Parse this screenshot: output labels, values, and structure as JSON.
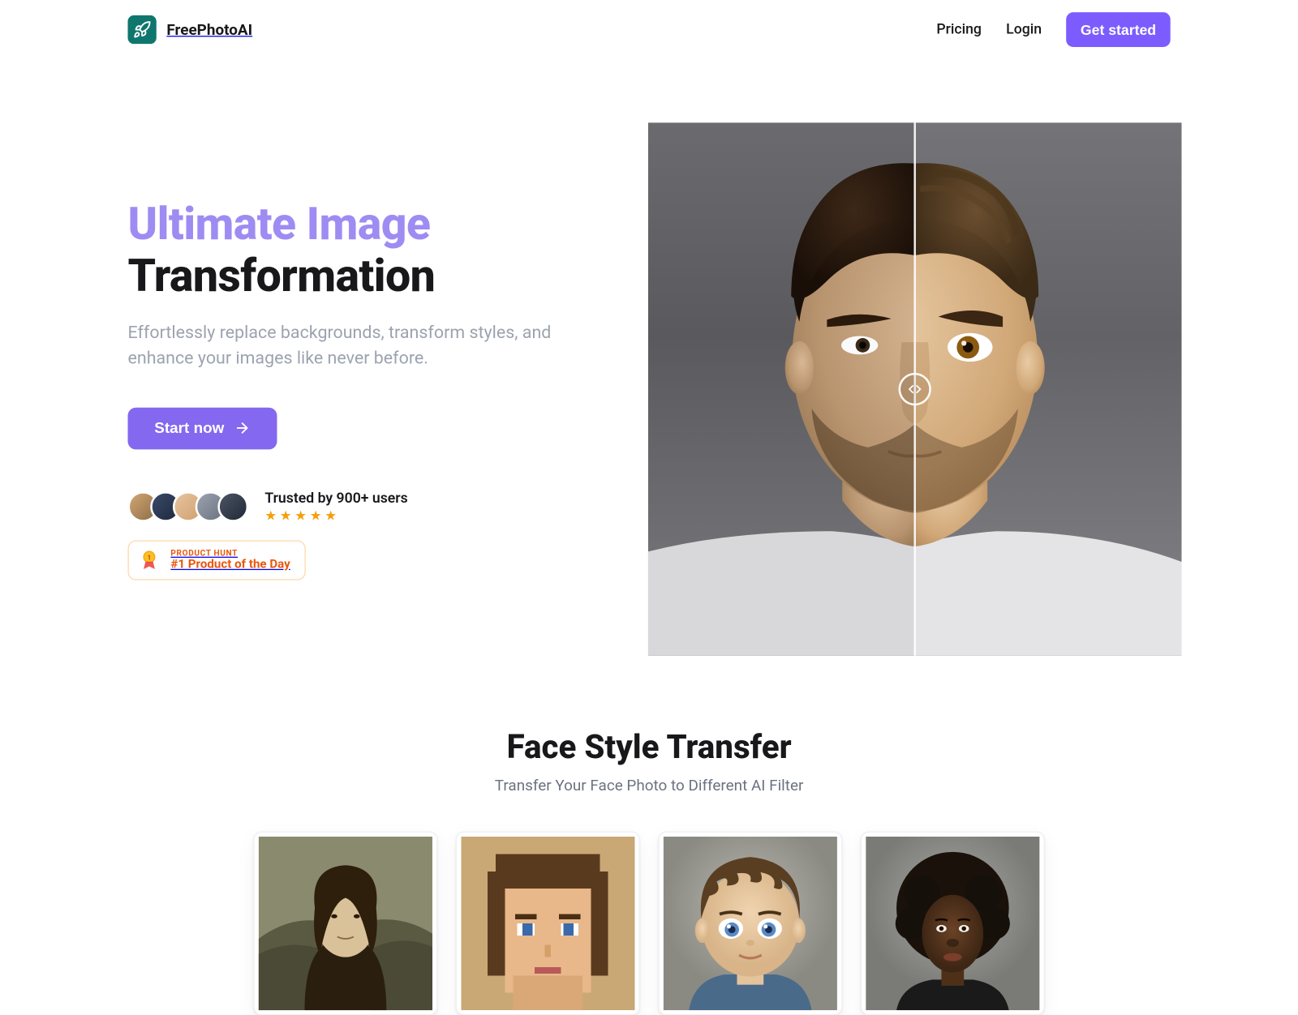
{
  "brand": {
    "name": "FreePhotoAI"
  },
  "nav": {
    "pricing": "Pricing",
    "login": "Login",
    "get_started": "Get started"
  },
  "hero": {
    "title_line1": "Ultimate Image",
    "title_line2": "Transformation",
    "subtitle": "Effortlessly replace backgrounds, transform styles, and enhance your images like never before.",
    "cta": "Start now",
    "trusted_by": "Trusted by 900+ users"
  },
  "product_hunt": {
    "kicker": "PRODUCT HUNT",
    "title": "#1 Product of the Day"
  },
  "section2": {
    "title": "Face Style Transfer",
    "subtitle": "Transfer Your Face Photo to Different AI Filter"
  },
  "colors": {
    "accent": "#9e8cf3",
    "primary_btn": "#8468f0",
    "star": "#f59e0b",
    "ph": "#ea580c"
  }
}
